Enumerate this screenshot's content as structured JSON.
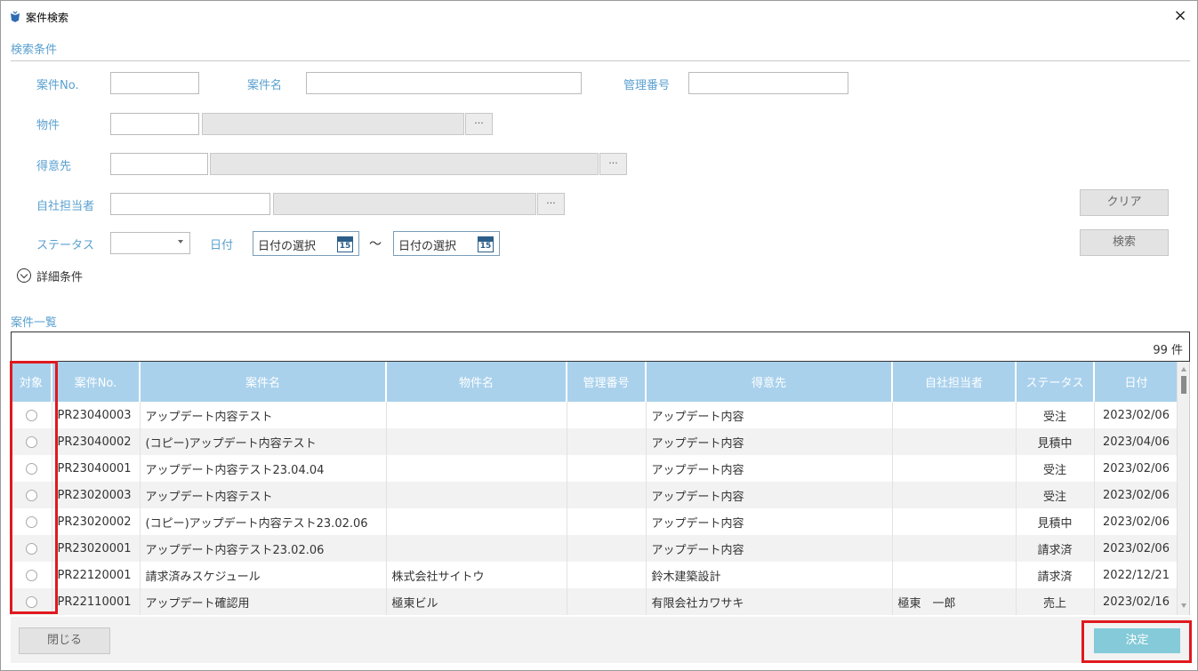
{
  "window": {
    "title": "案件検索",
    "close_glyph": "×"
  },
  "search": {
    "section_title": "検索条件",
    "case_no_label": "案件No.",
    "case_name_label": "案件名",
    "mgmt_no_label": "管理番号",
    "property_label": "物件",
    "customer_label": "得意先",
    "staff_label": "自社担当者",
    "status_label": "ステータス",
    "date_label": "日付",
    "date_from_placeholder": "日付の選択",
    "date_to_placeholder": "日付の選択",
    "date_sep": "～",
    "calendar_day": "15",
    "dots": "···",
    "clear_button": "クリア",
    "search_button": "検索",
    "detail_toggle": "詳細条件"
  },
  "list": {
    "section_title": "案件一覧",
    "count_text": "99 件",
    "columns": [
      "対象",
      "案件No.",
      "案件名",
      "物件名",
      "管理番号",
      "得意先",
      "自社担当者",
      "ステータス",
      "日付"
    ],
    "rows": [
      {
        "no": "PR23040003",
        "name": "アップデート内容テスト",
        "property": "",
        "mgmt": "",
        "customer": "アップデート内容",
        "staff": "",
        "status": "受注",
        "date": "2023/02/06"
      },
      {
        "no": "PR23040002",
        "name": "(コピー)アップデート内容テスト",
        "property": "",
        "mgmt": "",
        "customer": "アップデート内容",
        "staff": "",
        "status": "見積中",
        "date": "2023/04/06"
      },
      {
        "no": "PR23040001",
        "name": "アップデート内容テスト23.04.04",
        "property": "",
        "mgmt": "",
        "customer": "アップデート内容",
        "staff": "",
        "status": "受注",
        "date": "2023/02/06"
      },
      {
        "no": "PR23020003",
        "name": "アップデート内容テスト",
        "property": "",
        "mgmt": "",
        "customer": "アップデート内容",
        "staff": "",
        "status": "受注",
        "date": "2023/02/06"
      },
      {
        "no": "PR23020002",
        "name": "(コピー)アップデート内容テスト23.02.06",
        "property": "",
        "mgmt": "",
        "customer": "アップデート内容",
        "staff": "",
        "status": "見積中",
        "date": "2023/02/06"
      },
      {
        "no": "PR23020001",
        "name": "アップデート内容テスト23.02.06",
        "property": "",
        "mgmt": "",
        "customer": "アップデート内容",
        "staff": "",
        "status": "請求済",
        "date": "2023/02/06"
      },
      {
        "no": "PR22120001",
        "name": "請求済みスケジュール",
        "property": "株式会社サイトウ",
        "mgmt": "",
        "customer": "鈴木建築設計",
        "staff": "",
        "status": "請求済",
        "date": "2022/12/21"
      },
      {
        "no": "PR22110001",
        "name": "アップデート確認用",
        "property": "極東ビル",
        "mgmt": "",
        "customer": "有限会社カワサキ",
        "staff": "極東　一郎",
        "status": "売上",
        "date": "2023/02/16"
      }
    ]
  },
  "footer": {
    "close_button": "閉じる",
    "decide_button": "決定"
  },
  "colors": {
    "accent_label": "#5aa0cf",
    "header_bg": "#a9d1ec",
    "decide_bg": "#84cad8",
    "highlight": "#e0191e"
  }
}
